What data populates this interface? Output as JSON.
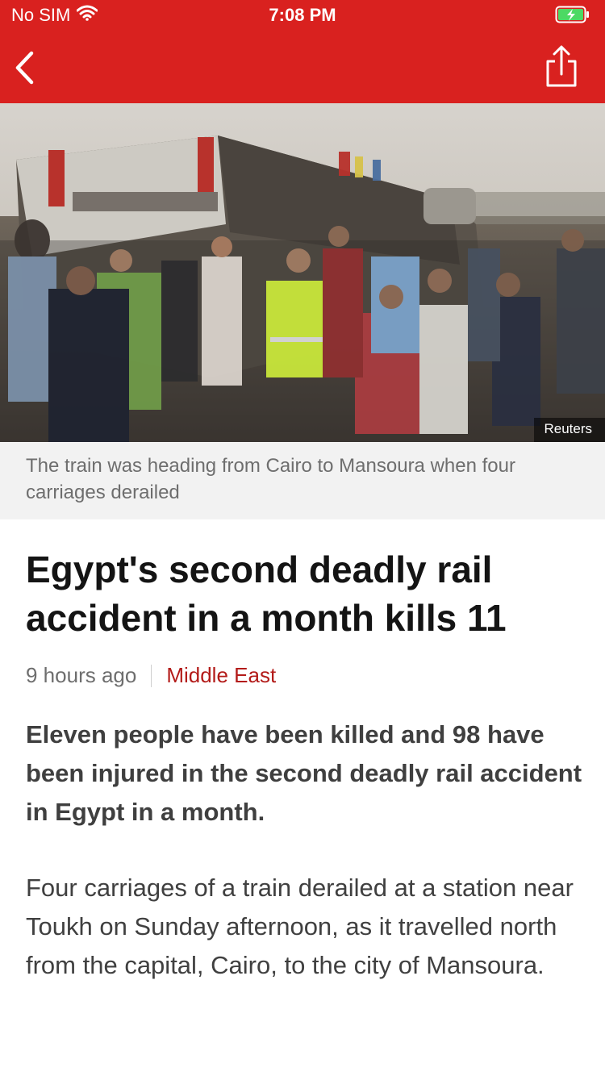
{
  "status_bar": {
    "carrier": "No SIM",
    "time": "7:08 PM"
  },
  "nav": {
    "back_icon": "chevron-left-icon",
    "share_icon": "share-icon",
    "background": "#d9211f"
  },
  "hero": {
    "credit": "Reuters",
    "caption": "The train was heading from Cairo to Mansoura when four carriages derailed"
  },
  "article": {
    "headline": "Egypt's second deadly rail accident in a month kills 11",
    "time_ago": "9 hours ago",
    "section": "Middle East",
    "section_color": "#b31b19",
    "summary": "Eleven people have been killed and 98 have been injured in the second deadly rail accident in Egypt in a month.",
    "paragraph_1": "Four carriages of a train derailed at a station near Toukh on Sunday afternoon, as it travelled north from the capital, Cairo, to the city of Mansoura."
  }
}
